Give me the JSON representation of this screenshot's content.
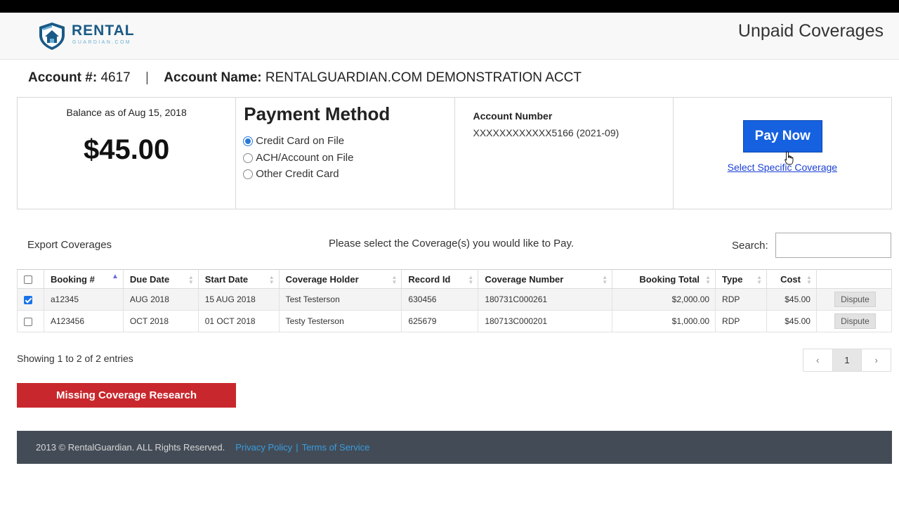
{
  "header": {
    "logo_text": "RENTAL",
    "logo_sub": "GUARDIAN.COM",
    "page_title": "Unpaid Coverages",
    "brand_color": "#1a5a86"
  },
  "account": {
    "number_label": "Account #:",
    "number": "4617",
    "separator": "|",
    "name_label": "Account Name:",
    "name": "RENTALGUARDIAN.COM DEMONSTRATION ACCT"
  },
  "balance": {
    "label": "Balance as of Aug 15, 2018",
    "amount": "$45.00"
  },
  "payment_method": {
    "title": "Payment Method",
    "options": [
      {
        "label": "Credit Card on File",
        "selected": true
      },
      {
        "label": "ACH/Account on File",
        "selected": false
      },
      {
        "label": "Other Credit Card",
        "selected": false
      }
    ]
  },
  "account_number": {
    "label": "Account Number",
    "value": "XXXXXXXXXXXX5166 (2021-09)"
  },
  "actions": {
    "pay_now": "Pay Now",
    "select_specific": "Select Specific Coverage",
    "pay_color": "#1561e0"
  },
  "toolbar": {
    "export": "Export Coverages",
    "instruction": "Please select the Coverage(s) you would like to Pay.",
    "search_label": "Search:",
    "search_value": ""
  },
  "table": {
    "columns": [
      "Booking #",
      "Due Date",
      "Start Date",
      "Coverage Holder",
      "Record Id",
      "Coverage Number",
      "Booking Total",
      "Type",
      "Cost"
    ],
    "rows": [
      {
        "checked": true,
        "booking": "a12345",
        "due": "AUG 2018",
        "start": "15 AUG 2018",
        "holder": "Test Testerson",
        "record": "630456",
        "coverage": "180731C000261",
        "total": "$2,000.00",
        "type": "RDP",
        "cost": "$45.00",
        "action": "Dispute"
      },
      {
        "checked": false,
        "booking": "A123456",
        "due": "OCT 2018",
        "start": "01 OCT 2018",
        "holder": "Testy Testerson",
        "record": "625679",
        "coverage": "180713C000201",
        "total": "$1,000.00",
        "type": "RDP",
        "cost": "$45.00",
        "action": "Dispute"
      }
    ]
  },
  "pagination": {
    "info": "Showing 1 to 2 of 2 entries",
    "prev": "‹",
    "page": "1",
    "next": "›"
  },
  "missing": {
    "label": "Missing Coverage Research",
    "color": "#c8282d"
  },
  "footer": {
    "copyright": "2013 © RentalGuardian. ALL Rights Reserved.",
    "privacy": "Privacy Policy",
    "separator": "|",
    "terms": "Terms of Service"
  }
}
